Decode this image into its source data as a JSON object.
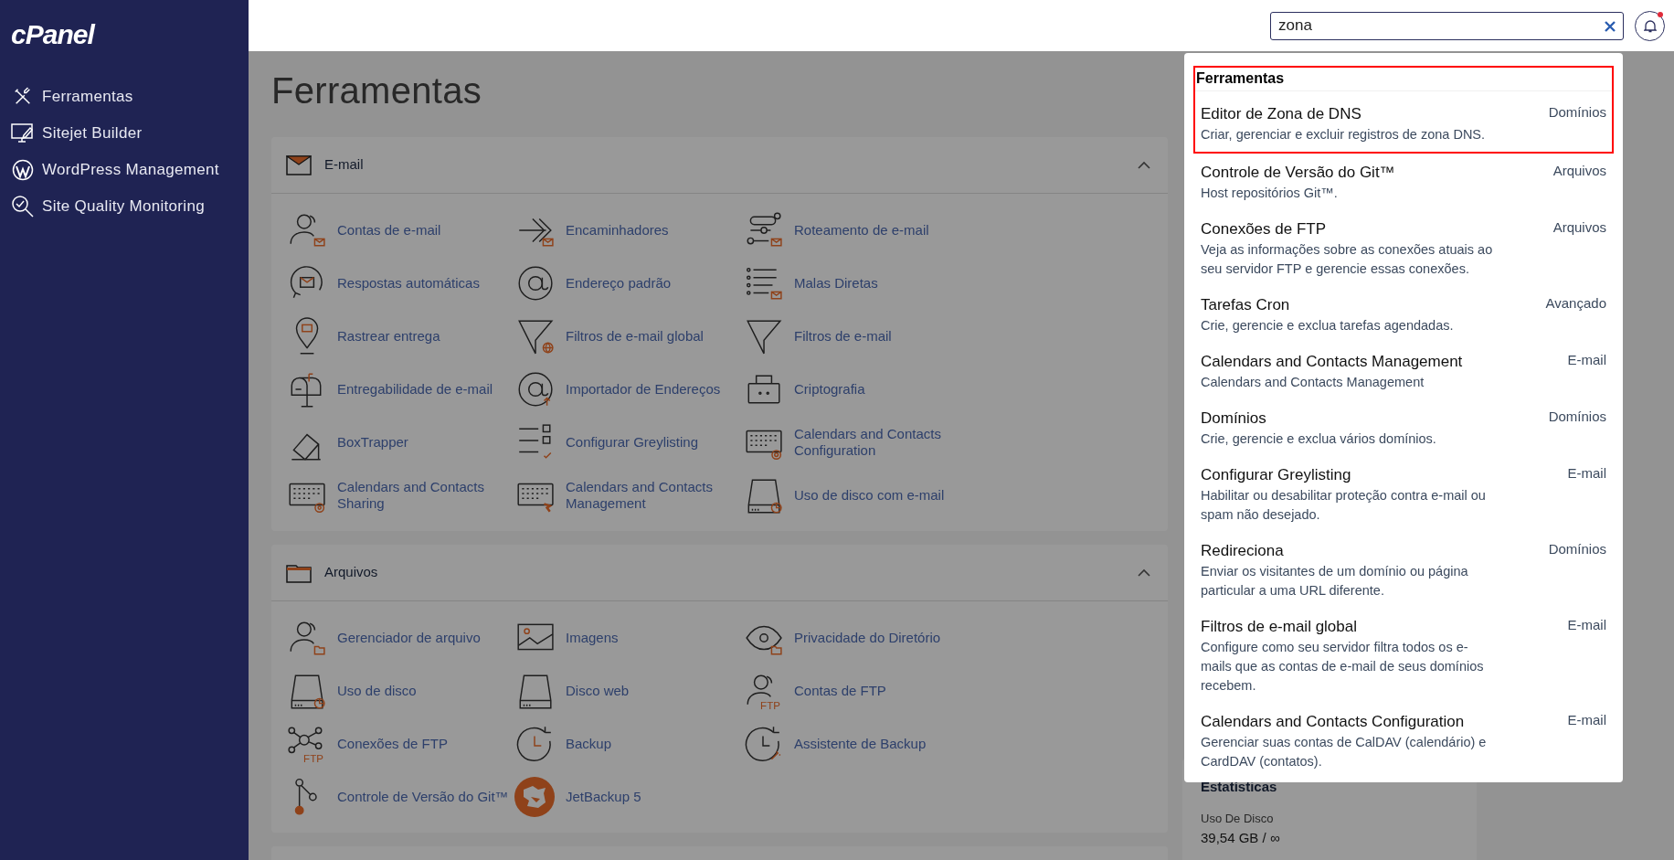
{
  "sidebar": {
    "logo": "cPanel",
    "items": [
      {
        "label": "Ferramentas"
      },
      {
        "label": "Sitejet Builder"
      },
      {
        "label": "WordPress Management"
      },
      {
        "label": "Site Quality Monitoring"
      }
    ]
  },
  "search": {
    "value": "zona"
  },
  "notifications": {
    "unread": true
  },
  "page_title": "Ferramentas",
  "sections": [
    {
      "title": "E-mail",
      "expanded": true,
      "tools": [
        {
          "label": "Contas de e-mail"
        },
        {
          "label": "Encaminhadores"
        },
        {
          "label": "Roteamento de e-mail"
        },
        {
          "label": "Respostas automáticas"
        },
        {
          "label": "Endereço padrão"
        },
        {
          "label": "Malas Diretas"
        },
        {
          "label": "Rastrear entrega"
        },
        {
          "label": "Filtros de e-mail global"
        },
        {
          "label": "Filtros de e-mail"
        },
        {
          "label": "Entregabilidade de e-mail"
        },
        {
          "label": "Importador de Endereços"
        },
        {
          "label": "Criptografia"
        },
        {
          "label": "BoxTrapper"
        },
        {
          "label": "Configurar Greylisting"
        },
        {
          "label": "Calendars and Contacts Configuration"
        },
        {
          "label": "Calendars and Contacts Sharing"
        },
        {
          "label": "Calendars and Contacts Management"
        },
        {
          "label": "Uso de disco com e-mail"
        }
      ]
    },
    {
      "title": "Arquivos",
      "expanded": true,
      "tools": [
        {
          "label": "Gerenciador de arquivo"
        },
        {
          "label": "Imagens"
        },
        {
          "label": "Privacidade do Diretório"
        },
        {
          "label": "Uso de disco"
        },
        {
          "label": "Disco web"
        },
        {
          "label": "Contas de FTP",
          "badge": "FTP"
        },
        {
          "label": "Conexões de FTP",
          "badge": "FTP"
        },
        {
          "label": "Backup"
        },
        {
          "label": "Assistente de Backup"
        },
        {
          "label": "Controle de Versão do Git™"
        },
        {
          "label": "JetBackup 5"
        }
      ]
    }
  ],
  "stats": {
    "title": "Estatísticas",
    "items": [
      {
        "label": "Uso De Disco",
        "value": "39,54 GB / ∞"
      }
    ]
  },
  "search_results": {
    "group": "Ferramentas",
    "items": [
      {
        "title": "Editor de Zona de DNS",
        "description": "Criar, gerenciar e excluir registros de zona DNS.",
        "category": "Domínios",
        "framed": true
      },
      {
        "title": "Controle de Versão do Git™",
        "description": "Host repositórios Git™.",
        "category": "Arquivos",
        "framed": false
      },
      {
        "title": "Conexões de FTP",
        "description": "Veja as informações sobre as conexões atuais ao seu servidor FTP e gerencie essas conexões.",
        "category": "Arquivos",
        "framed": false
      },
      {
        "title": "Tarefas Cron",
        "description": "Crie, gerencie e exclua tarefas agendadas.",
        "category": "Avançado",
        "framed": false
      },
      {
        "title": "Calendars and Contacts Management",
        "description": "Calendars and Contacts Management",
        "category": "E-mail",
        "framed": false
      },
      {
        "title": "Domínios",
        "description": "Crie, gerencie e exclua vários domínios.",
        "category": "Domínios",
        "framed": false
      },
      {
        "title": "Configurar Greylisting",
        "description": "Habilitar ou desabilitar proteção contra e-mail ou spam não desejado.",
        "category": "E-mail",
        "framed": false
      },
      {
        "title": "Redireciona",
        "description": "Enviar os visitantes de um domínio ou página particular a uma URL diferente.",
        "category": "Domínios",
        "framed": false
      },
      {
        "title": "Filtros de e-mail global",
        "description": "Configure como seu servidor filtra todos os e-mails que as contas de e-mail de seus domínios recebem.",
        "category": "E-mail",
        "framed": false
      },
      {
        "title": "Calendars and Contacts Configuration",
        "description": "Gerenciar suas contas de CalDAV (calendário) e CardDAV (contatos).",
        "category": "E-mail",
        "framed": false
      }
    ]
  }
}
